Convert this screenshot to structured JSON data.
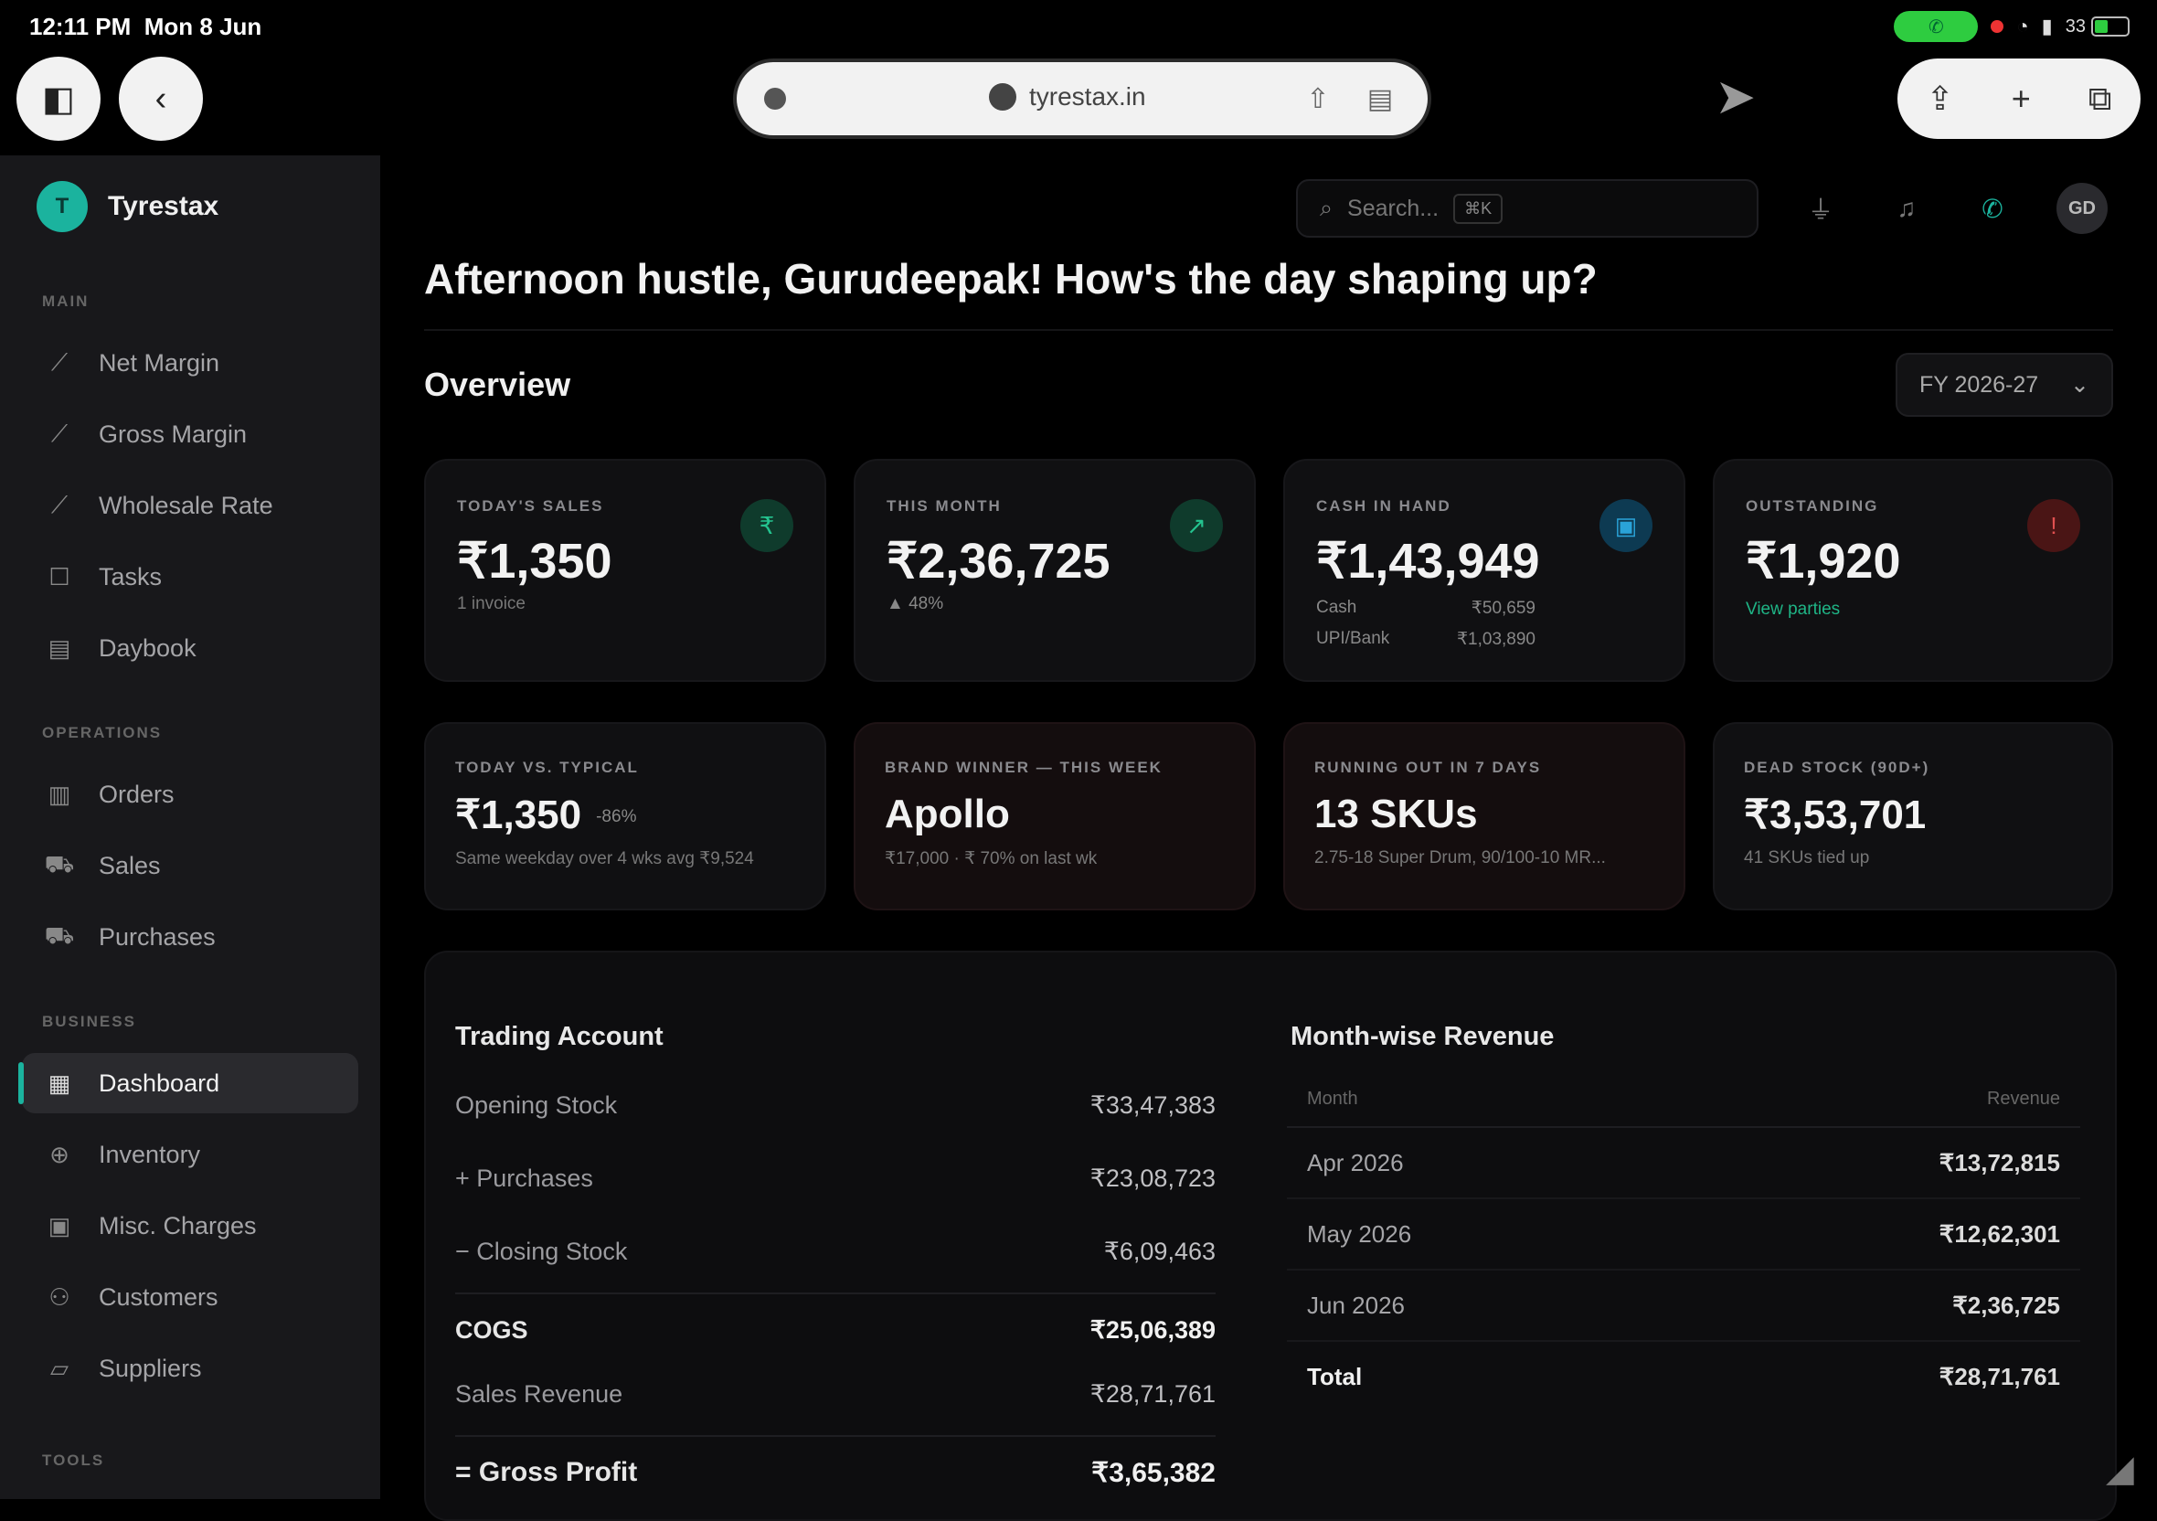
{
  "status": {
    "time": "12:11 PM",
    "date": "Mon 8 Jun",
    "battery": "33"
  },
  "browser": {
    "url": "tyrestax.in"
  },
  "app": {
    "brand_initial": "T",
    "brand_name": "Tyrestax"
  },
  "sidebar": {
    "sections": [
      {
        "title": "MAIN",
        "items": [
          {
            "label": "Net Margin",
            "icon": "trend-icon"
          },
          {
            "label": "Gross Margin",
            "icon": "trend-icon"
          },
          {
            "label": "Wholesale Rate",
            "icon": "trend-icon"
          },
          {
            "label": "Tasks",
            "icon": "checklist-icon"
          },
          {
            "label": "Daybook",
            "icon": "book-icon"
          }
        ]
      },
      {
        "title": "OPERATIONS",
        "items": [
          {
            "label": "Orders",
            "icon": "clipboard-icon"
          },
          {
            "label": "Sales",
            "icon": "cart-icon"
          },
          {
            "label": "Purchases",
            "icon": "truck-icon"
          }
        ]
      },
      {
        "title": "BUSINESS",
        "items": [
          {
            "label": "Dashboard",
            "icon": "grid-icon",
            "active": true
          },
          {
            "label": "Inventory",
            "icon": "box-icon"
          },
          {
            "label": "Misc. Charges",
            "icon": "receipt-icon"
          },
          {
            "label": "Customers",
            "icon": "users-icon"
          },
          {
            "label": "Suppliers",
            "icon": "folder-icon"
          }
        ]
      },
      {
        "title": "TOOLS",
        "items": []
      }
    ]
  },
  "topbar": {
    "search_placeholder": "Search...",
    "search_shortcut": "⌘K",
    "avatar_initials": "GD"
  },
  "main": {
    "greeting": "Afternoon hustle, Gurudeepak! How's the day shaping up?",
    "overview_title": "Overview",
    "fy_selected": "FY 2026-27"
  },
  "kpi_cards": [
    {
      "label": "TODAY'S SALES",
      "value": "₹1,350",
      "sub": "1 invoice",
      "icon": "rupee-icon",
      "icon_bg": "#0f3b2c",
      "icon_color": "#24c38f"
    },
    {
      "label": "THIS MONTH",
      "value": "₹2,36,725",
      "sub": "▲ 48%",
      "icon": "trend-up-icon",
      "icon_bg": "#0f3b2c",
      "icon_color": "#24c38f"
    },
    {
      "label": "CASH IN HAND",
      "value": "₹1,43,949",
      "rows": [
        {
          "k": "Cash",
          "v": "₹50,659"
        },
        {
          "k": "UPI/Bank",
          "v": "₹1,03,890"
        }
      ],
      "icon": "wallet-icon",
      "icon_bg": "#0d3a52",
      "icon_color": "#2aa3d8"
    },
    {
      "label": "OUTSTANDING",
      "value": "₹1,920",
      "sub": "View parties",
      "sub_color": "#1fb586",
      "icon": "alert-icon",
      "icon_bg": "#4a1515",
      "icon_color": "#e05050"
    }
  ],
  "insight_cards": [
    {
      "label": "TODAY VS. TYPICAL",
      "value": "₹1,350",
      "badge": "-86%",
      "sub": "Same weekday over 4 wks avg ₹9,524"
    },
    {
      "label": "BRAND WINNER — THIS WEEK",
      "value": "Apollo",
      "sub": "₹17,000 · ₹ 70% on last wk"
    },
    {
      "label": "RUNNING OUT IN 7 DAYS",
      "value": "13 SKUs",
      "sub": "2.75-18 Super Drum, 90/100-10 MR..."
    },
    {
      "label": "DEAD STOCK (90D+)",
      "value": "₹3,53,701",
      "sub": "41 SKUs tied up"
    }
  ],
  "trading_account": {
    "title": "Trading Account",
    "rows": [
      {
        "label": "Opening Stock",
        "value": "₹33,47,383"
      },
      {
        "label": "+ Purchases",
        "value": "₹23,08,723"
      },
      {
        "label": "− Closing Stock",
        "value": "₹6,09,463"
      },
      {
        "label": "COGS",
        "value": "₹25,06,389",
        "bold": true
      },
      {
        "label": "Sales Revenue",
        "value": "₹28,71,761"
      },
      {
        "label": "= Gross Profit",
        "value": "₹3,65,382",
        "bold": true
      }
    ]
  },
  "month_revenue": {
    "title": "Month-wise Revenue",
    "columns": [
      "Month",
      "Revenue"
    ],
    "rows": [
      {
        "month": "Apr 2026",
        "revenue": "₹13,72,815"
      },
      {
        "month": "May 2026",
        "revenue": "₹12,62,301"
      },
      {
        "month": "Jun 2026",
        "revenue": "₹2,36,725"
      }
    ],
    "total_label": "Total",
    "total_value": "₹28,71,761"
  }
}
